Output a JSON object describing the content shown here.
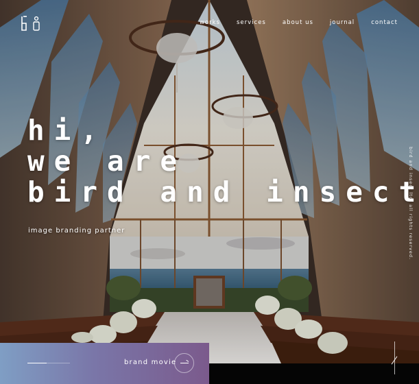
{
  "nav": {
    "items": [
      "works",
      "services",
      "about us",
      "journal",
      "contact"
    ]
  },
  "hero": {
    "lines": [
      "hi,",
      "we are",
      "bird and insect."
    ],
    "tagline": "image branding partner"
  },
  "copyright": "bird and insect ltd. all rights reserved.",
  "movie": {
    "label": "brand movie"
  },
  "colors": {
    "movie_bar_start": "#7f9ec4",
    "movie_bar_end": "#7b5a8c",
    "dark_bar": "#050505"
  },
  "icons": [
    "logo-mark-icon",
    "arrow-right-icon"
  ]
}
